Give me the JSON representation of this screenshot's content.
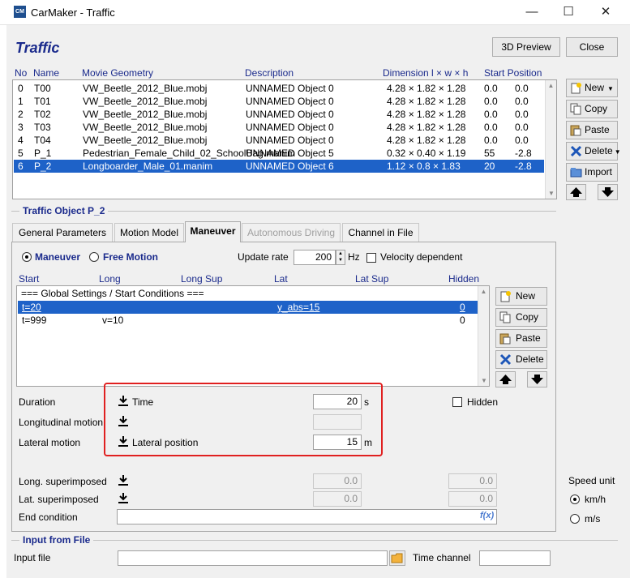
{
  "window": {
    "app_icon_text": "CM",
    "title": "CarMaker - Traffic",
    "minimize": "—",
    "maximize": "☐",
    "close": "✕"
  },
  "heading": "Traffic",
  "top_buttons": {
    "preview": "3D Preview",
    "close": "Close"
  },
  "traffic_table": {
    "headers": [
      "No",
      "Name",
      "Movie Geometry",
      "Description",
      "Dimension l × w × h",
      "Start Position"
    ],
    "rows": [
      {
        "no": "0",
        "name": "T00",
        "geometry": "VW_Beetle_2012_Blue.mobj",
        "desc": "UNNAMED Object 0",
        "dim": "4.28 × 1.82 × 1.28",
        "s": "0.0",
        "t": "0.0"
      },
      {
        "no": "1",
        "name": "T01",
        "geometry": "VW_Beetle_2012_Blue.mobj",
        "desc": "UNNAMED Object 0",
        "dim": "4.28 × 1.82 × 1.28",
        "s": "0.0",
        "t": "0.0"
      },
      {
        "no": "2",
        "name": "T02",
        "geometry": "VW_Beetle_2012_Blue.mobj",
        "desc": "UNNAMED Object 0",
        "dim": "4.28 × 1.82 × 1.28",
        "s": "0.0",
        "t": "0.0"
      },
      {
        "no": "3",
        "name": "T03",
        "geometry": "VW_Beetle_2012_Blue.mobj",
        "desc": "UNNAMED Object 0",
        "dim": "4.28 × 1.82 × 1.28",
        "s": "0.0",
        "t": "0.0"
      },
      {
        "no": "4",
        "name": "T04",
        "geometry": "VW_Beetle_2012_Blue.mobj",
        "desc": "UNNAMED Object 0",
        "dim": "4.28 × 1.82 × 1.28",
        "s": "0.0",
        "t": "0.0"
      },
      {
        "no": "5",
        "name": "P_1",
        "geometry": "Pedestrian_Female_Child_02_SchoolBag.manim",
        "desc": "UNNAMED Object 5",
        "dim": "0.32 × 0.40 × 1.19",
        "s": "55",
        "t": "-2.8"
      },
      {
        "no": "6",
        "name": "P_2",
        "geometry": "Longboarder_Male_01.manim",
        "desc": "UNNAMED Object 6",
        "dim": "1.12 × 0.8 × 1.83",
        "s": "20",
        "t": "-2.8"
      }
    ],
    "selected_index": 6
  },
  "side_buttons": {
    "new": "New",
    "copy": "Copy",
    "paste": "Paste",
    "delete": "Delete",
    "import": "Import"
  },
  "traffic_object_title": "Traffic Object P_2",
  "tabs": [
    "General Parameters",
    "Motion Model",
    "Maneuver",
    "Autonomous Driving",
    "Channel in File"
  ],
  "active_tab": "Maneuver",
  "maneuver": {
    "radio_maneuver": "Maneuver",
    "radio_free": "Free Motion",
    "update_rate_label": "Update rate",
    "update_rate_value": "200",
    "update_rate_unit": "Hz",
    "velocity_dependent": "Velocity dependent",
    "table_headers": [
      "Start",
      "Long",
      "Long Sup",
      "Lat",
      "Lat Sup",
      "Hidden"
    ],
    "global_row": "=== Global Settings / Start Conditions ===",
    "rows": [
      {
        "start": "t=20",
        "long": "",
        "lat": "y_abs=15",
        "hidden": "0"
      },
      {
        "start": "t=999",
        "long": "v=10",
        "lat": "",
        "hidden": "0"
      }
    ],
    "buttons": {
      "new": "New",
      "copy": "Copy",
      "paste": "Paste",
      "delete": "Delete"
    }
  },
  "params": {
    "duration_label": "Duration",
    "duration_mode": "Time",
    "duration_value": "20",
    "duration_unit": "s",
    "hidden_label": "Hidden",
    "longitudinal_label": "Longitudinal motion",
    "lateral_label": "Lateral motion",
    "lateral_mode": "Lateral position",
    "lateral_value": "15",
    "lateral_unit": "m",
    "long_sup_label": "Long. superimposed",
    "long_sup_v1": "0.0",
    "long_sup_v2": "0.0",
    "lat_sup_label": "Lat. superimposed",
    "lat_sup_v1": "0.0",
    "lat_sup_v2": "0.0",
    "end_condition_label": "End condition",
    "fx_icon": "f(x)"
  },
  "speed_unit": {
    "label": "Speed unit",
    "kmh": "km/h",
    "ms": "m/s",
    "selected": "km/h"
  },
  "input_from_file": {
    "title": "Input from File",
    "input_label": "Input file",
    "time_channel_label": "Time channel"
  }
}
